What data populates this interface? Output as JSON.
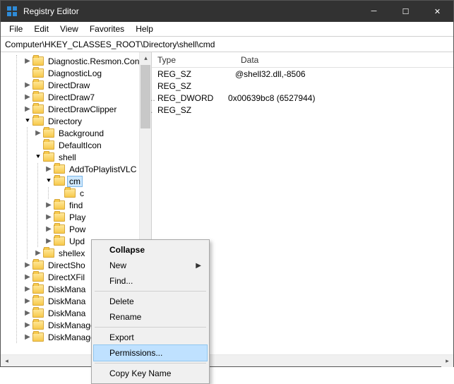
{
  "window": {
    "title": "Registry Editor"
  },
  "menu": {
    "file": "File",
    "edit": "Edit",
    "view": "View",
    "favorites": "Favorites",
    "help": "Help"
  },
  "address": {
    "path": "Computer\\HKEY_CLASSES_ROOT\\Directory\\shell\\cmd"
  },
  "tree": {
    "n0": "Diagnostic.Resmon.Con",
    "n1": "DiagnosticLog",
    "n2": "DirectDraw",
    "n3": "DirectDraw7",
    "n4": "DirectDrawClipper",
    "n5": "Directory",
    "n6": "Background",
    "n7": "DefaultIcon",
    "n8": "shell",
    "n9": "AddToPlaylistVLC",
    "n10": "cm",
    "n11": "c",
    "n12": "find",
    "n13": "Play",
    "n14": "Pow",
    "n15": "Upd",
    "n16": "shellex",
    "n17": "DirectSho",
    "n18": "DirectXFil",
    "n19": "DiskMana",
    "n20": "DiskMana",
    "n21": "DiskMana",
    "n22": "DiskManagement.Snap",
    "n23": "DiskManagement.Snap"
  },
  "list": {
    "col_type": "Type",
    "col_data": "Data",
    "rows": [
      {
        "type": "REG_SZ",
        "data": "@shell32.dll,-8506"
      },
      {
        "type": "REG_SZ",
        "data": ""
      },
      {
        "type": "REG_DWORD",
        "data": "0x00639bc8 (6527944)"
      },
      {
        "type": "REG_SZ",
        "data": ""
      }
    ]
  },
  "context_menu": {
    "collapse": "Collapse",
    "new": "New",
    "find": "Find...",
    "delete": "Delete",
    "rename": "Rename",
    "export": "Export",
    "permissions": "Permissions...",
    "copy_key_name": "Copy Key Name"
  }
}
